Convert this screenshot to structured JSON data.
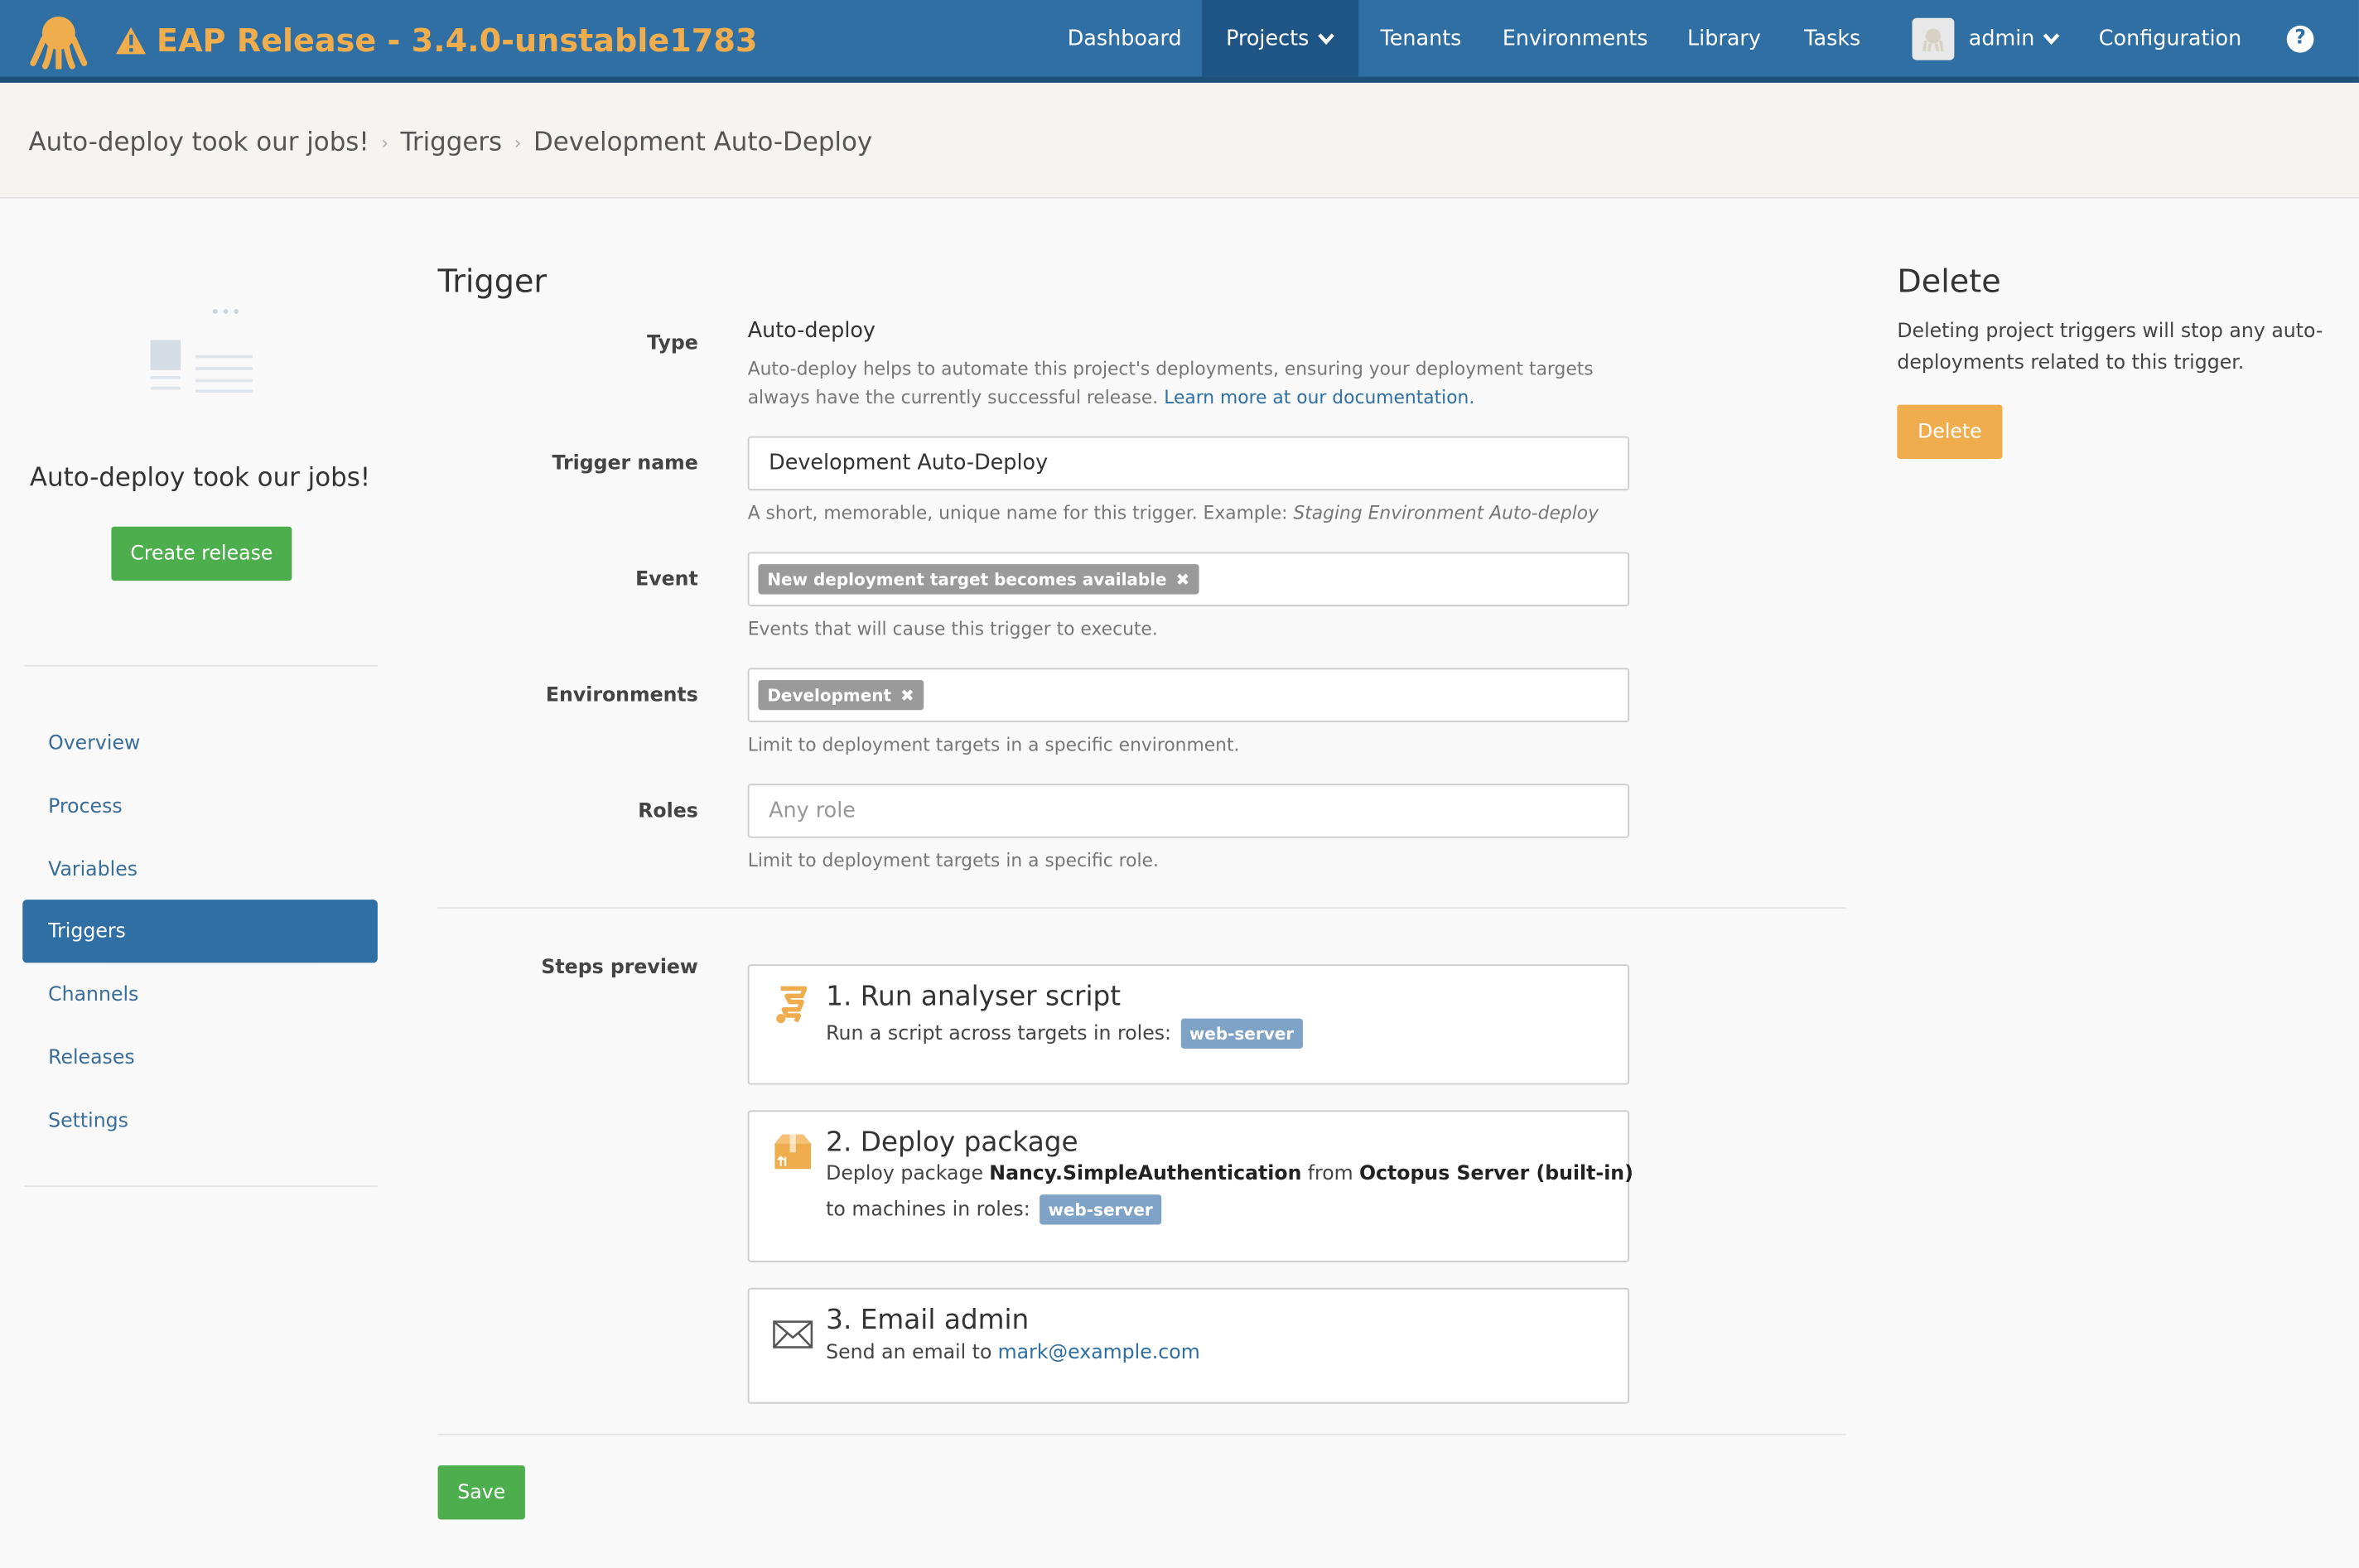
{
  "header": {
    "title": "EAP Release - 3.4.0-unstable1783",
    "nav": {
      "dashboard": "Dashboard",
      "projects": "Projects",
      "tenants": "Tenants",
      "environments": "Environments",
      "library": "Library",
      "tasks": "Tasks",
      "user": "admin",
      "configuration": "Configuration"
    },
    "help_glyph": "?",
    "colors": {
      "navbar": "#2f6fa3",
      "brand": "#f0ad4e"
    }
  },
  "breadcrumb": {
    "project": "Auto-deploy took our jobs!",
    "section": "Triggers",
    "current": "Development Auto-Deploy"
  },
  "sidebar": {
    "project_name": "Auto-deploy took our jobs!",
    "create_release": "Create release",
    "items": [
      {
        "label": "Overview"
      },
      {
        "label": "Process"
      },
      {
        "label": "Variables"
      },
      {
        "label": "Triggers",
        "active": true
      },
      {
        "label": "Channels"
      },
      {
        "label": "Releases"
      },
      {
        "label": "Settings"
      }
    ]
  },
  "form": {
    "heading": "Trigger",
    "type": {
      "label": "Type",
      "value": "Auto-deploy",
      "help_line1": "Auto-deploy helps to automate this project's deployments, ensuring your deployment targets",
      "help_line2": "always have the currently successful release.",
      "help_link": "Learn more at our documentation."
    },
    "name": {
      "label": "Trigger name",
      "value": "Development Auto-Deploy",
      "help": "A short, memorable, unique name for this trigger. Example:",
      "help_example": "Staging Environment Auto-deploy"
    },
    "event": {
      "label": "Event",
      "chip": "New deployment target becomes available",
      "help": "Events that will cause this trigger to execute."
    },
    "environments": {
      "label": "Environments",
      "chip": "Development",
      "help": "Limit to deployment targets in a specific environment."
    },
    "roles": {
      "label": "Roles",
      "placeholder": "Any role",
      "help": "Limit to deployment targets in a specific role."
    },
    "steps": {
      "label": "Steps preview",
      "items": [
        {
          "icon": "script-icon",
          "title": "1. Run analyser script",
          "text": "Run a script across targets in roles:",
          "role": "web-server"
        },
        {
          "icon": "package-icon",
          "title": "2. Deploy package",
          "pre": "Deploy package",
          "package": "Nancy.SimpleAuthentication",
          "mid": "from",
          "feed": "Octopus Server (built-in)",
          "line2": "to machines in roles:",
          "role": "web-server"
        },
        {
          "icon": "email-icon",
          "title": "3. Email admin",
          "text": "Send an email to",
          "email": "mark@example.com"
        }
      ]
    },
    "save": "Save"
  },
  "delete_panel": {
    "heading": "Delete",
    "text": "Deleting project triggers will stop any auto-deployments related to this trigger.",
    "button": "Delete"
  }
}
